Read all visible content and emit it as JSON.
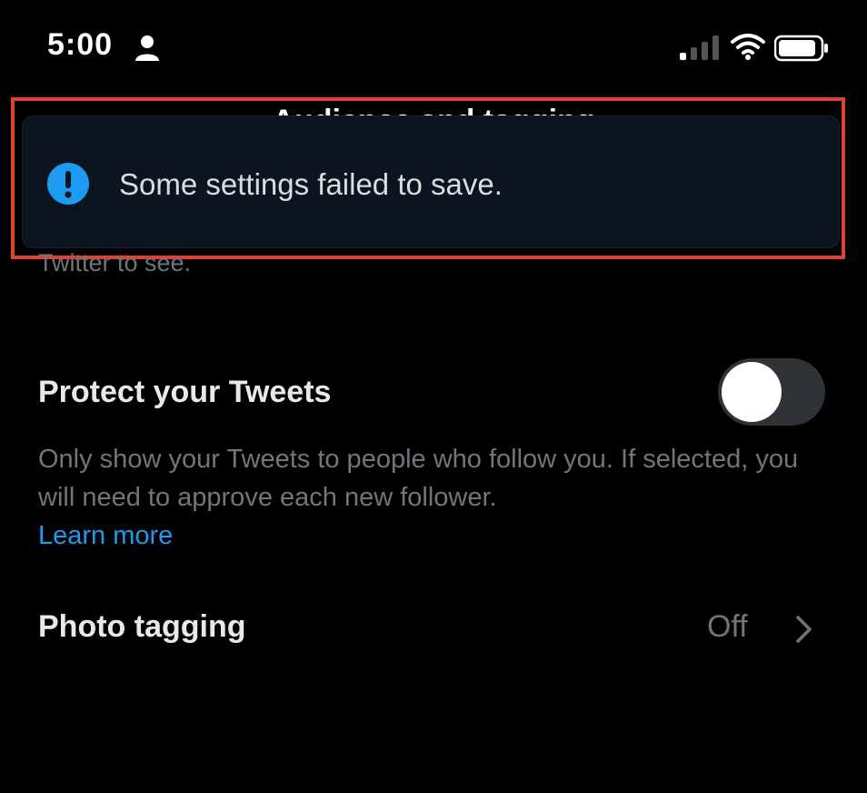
{
  "status_bar": {
    "time": "5:00"
  },
  "page": {
    "title": "Audience and tagging",
    "intro_tail": "Twitter to see."
  },
  "toast": {
    "message": "Some settings failed to save.",
    "icon": "exclamation-circle-icon",
    "accent_color": "#1d9bf0"
  },
  "protect": {
    "title": "Protect your Tweets",
    "description": "Only show your Tweets to people who follow you. If selected, you will need to approve each new follower.",
    "learn_more": "Learn more",
    "toggle_on": false
  },
  "photo_tagging": {
    "title": "Photo tagging",
    "value": "Off"
  },
  "colors": {
    "background": "#000000",
    "toast_bg": "#0b1520",
    "highlight": "#e2412a",
    "link": "#1d9bf0"
  }
}
